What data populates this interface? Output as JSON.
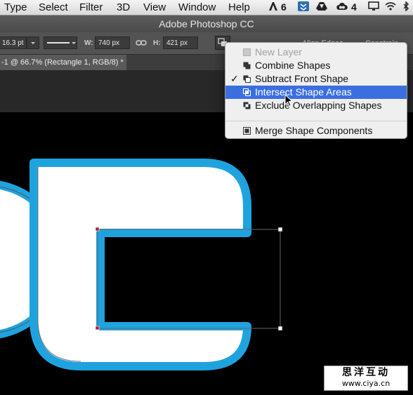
{
  "menubar": {
    "items": [
      "Type",
      "Select",
      "Filter",
      "3D",
      "View",
      "Window",
      "Help"
    ],
    "tray_badge_a": "6",
    "tray_badge_b": "4"
  },
  "window": {
    "title": "Adobe Photoshop CC"
  },
  "options": {
    "stroke_size": "16.3 pt",
    "width_label": "W:",
    "width_value": "740 px",
    "height_label": "H:",
    "height_value": "421 px",
    "align_edges_label": "Align Edges",
    "constrain_path_label": "Constrain Path"
  },
  "document_tab": {
    "label": "-1 @ 66.7% (Rectangle 1, RGB/8) *"
  },
  "path_ops_menu": {
    "items": [
      {
        "label": "New Layer",
        "state": "disabled"
      },
      {
        "label": "Combine Shapes",
        "state": "normal"
      },
      {
        "label": "Subtract Front Shape",
        "state": "checked"
      },
      {
        "label": "Intersect Shape Areas",
        "state": "highlighted"
      },
      {
        "label": "Exclude Overlapping Shapes",
        "state": "normal"
      },
      {
        "label": "Merge Shape Components",
        "state": "normal"
      }
    ]
  },
  "colors": {
    "shape_stroke": "#1fa3df",
    "menu_highlight": "#3b6fe0",
    "canvas": "#000000"
  },
  "watermark": {
    "line1": "思洋互动",
    "line2": "www.ciya.cn"
  }
}
